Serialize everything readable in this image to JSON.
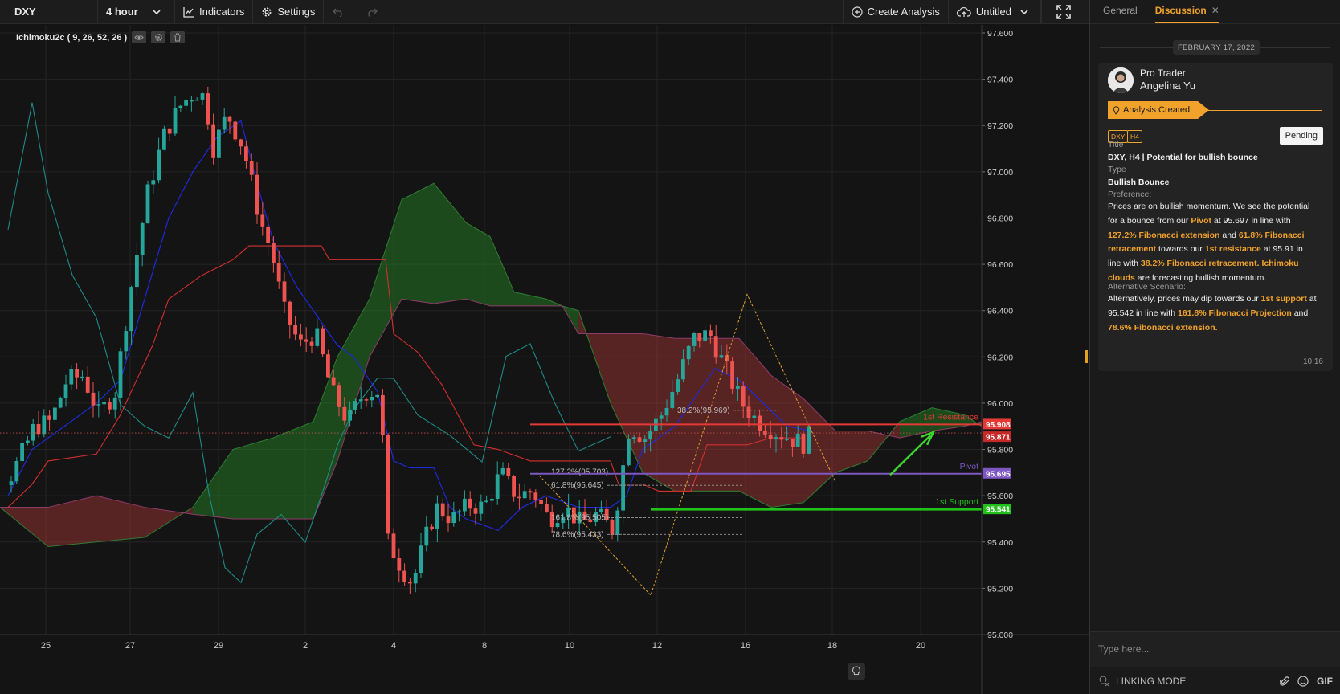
{
  "toolbar": {
    "symbol": "DXY",
    "interval": "4 hour",
    "indicators_label": "Indicators",
    "settings_label": "Settings",
    "create_analysis_label": "Create Analysis",
    "layout_name": "Untitled"
  },
  "chart": {
    "indicator_legend": "Ichimoku2c ( 9, 26, 52, 26 )",
    "price_ticks": [
      "97.600",
      "97.400",
      "97.200",
      "97.000",
      "96.800",
      "96.600",
      "96.400",
      "96.200",
      "96.000",
      "95.800",
      "95.600",
      "95.400",
      "95.200",
      "95.000"
    ],
    "date_ticks": [
      "25",
      "27",
      "29",
      "2",
      "4",
      "8",
      "10",
      "12",
      "16",
      "18",
      "20"
    ],
    "levels": [
      {
        "name": "1st Resistance",
        "price": 95.908,
        "label": "95.908",
        "color": "#e53935"
      },
      {
        "name": "Pivot",
        "price": 95.695,
        "label": "95.695",
        "color": "#7e57c2"
      },
      {
        "name": "1st Support",
        "price": 95.541,
        "label": "95.541",
        "color": "#22c01a"
      }
    ],
    "current_price": {
      "label": "95.871",
      "value": 95.871
    },
    "fib_labels": [
      {
        "text": "38.2%(95.969)",
        "price": 95.969
      },
      {
        "text": "127.2%(95.703)",
        "price": 95.703
      },
      {
        "text": "61.8%(95.645)",
        "price": 95.645
      },
      {
        "text": "161.8%(95.505)",
        "price": 95.505
      },
      {
        "text": "78.6%(95.433)",
        "price": 95.433
      }
    ],
    "colors": {
      "up": "#26a69a",
      "down": "#ef5350",
      "kijun": "#d32f2f",
      "tenkan": "#1e2ad8",
      "chikou": "#1f8a86",
      "fib": "#e0a030"
    }
  },
  "panel": {
    "tabs": [
      "General",
      "Discussion"
    ],
    "active_tab": "Discussion",
    "date_separator": "FEBRUARY 17, 2022",
    "author_role": "Pro Trader",
    "author_name": "Angelina Yu",
    "badge": "Analysis Created",
    "tags": [
      "DXY",
      "H4"
    ],
    "status": "Pending",
    "title_label": "Title",
    "title_value": "DXY, H4 | Potential for bullish bounce",
    "type_label": "Type",
    "type_value": "Bullish Bounce",
    "preference_label": "Preference:",
    "preference": {
      "t1": "Prices are on bullish momentum. We see the potential for a bounce from our ",
      "h1": "Pivot",
      "t2": " at 95.697 in line with ",
      "h2": "127.2% Fibonacci extension",
      "t3": " and ",
      "h3": "61.8% Fibonacci retracement",
      "t4": " towards our ",
      "h4": "1st resistance",
      "t5": " at 95.91 in line with ",
      "h5": "38.2% Fibonacci retracement.",
      "t6": "  ",
      "h6": "Ichimoku clouds",
      "t7": " are forecasting bullish momentum."
    },
    "alt_label": "Alternative Scenario:",
    "alternative": {
      "t1": "Alternatively, prices may dip towards our ",
      "h1": "1st support",
      "t2": " at 95.542 in line with ",
      "h2": "161.8% Fibonacci Projection",
      "t3": " and ",
      "h3": "78.6% Fibonacci extension."
    },
    "time": "10:16",
    "input_placeholder": "Type here...",
    "linking_mode": "LINKING MODE",
    "gif_label": "GIF"
  }
}
